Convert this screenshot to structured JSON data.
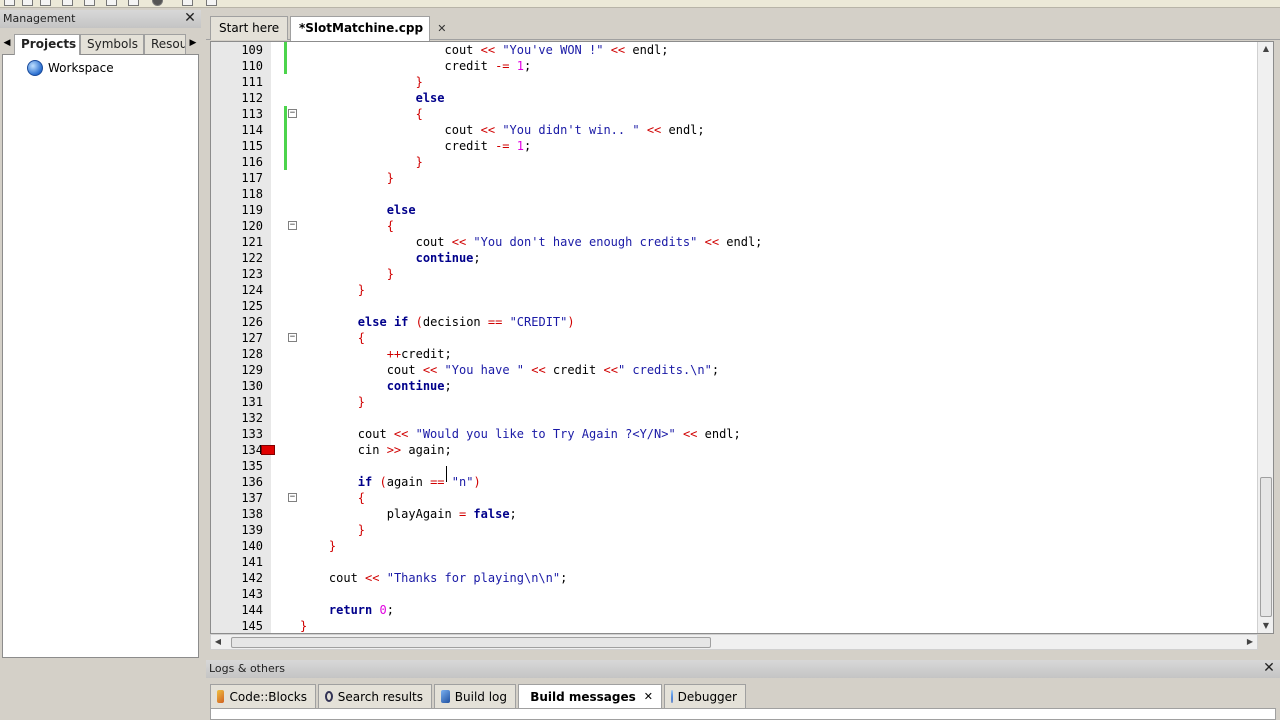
{
  "management_panel": {
    "title": "Management",
    "close_glyph": "✕",
    "tabs": [
      "Projects",
      "Symbols",
      "Resources"
    ],
    "active_tab": "Projects",
    "tree": {
      "root_label": "Workspace",
      "root_icon": "workspace-globe-icon"
    }
  },
  "editor": {
    "tabs": [
      {
        "label": "Start here",
        "active": false
      },
      {
        "label": "*SlotMatchine.cpp",
        "active": true,
        "close_glyph": "✕"
      }
    ],
    "lines": [
      {
        "num": "109",
        "code": "                    cout << \"You've WON !\" << endl;"
      },
      {
        "num": "110",
        "code": "                    credit -= 1;"
      },
      {
        "num": "111",
        "code": "                }"
      },
      {
        "num": "112",
        "code": "                else"
      },
      {
        "num": "113",
        "code": "                {"
      },
      {
        "num": "114",
        "code": "                    cout << \"You didn't win.. \" << endl;"
      },
      {
        "num": "115",
        "code": "                    credit -= 1;"
      },
      {
        "num": "116",
        "code": "                }"
      },
      {
        "num": "117",
        "code": "            }"
      },
      {
        "num": "118",
        "code": ""
      },
      {
        "num": "119",
        "code": "            else"
      },
      {
        "num": "120",
        "code": "            {"
      },
      {
        "num": "121",
        "code": "                cout << \"You don't have enough credits\" << endl;"
      },
      {
        "num": "122",
        "code": "                continue;"
      },
      {
        "num": "123",
        "code": "            }"
      },
      {
        "num": "124",
        "code": "        }"
      },
      {
        "num": "125",
        "code": ""
      },
      {
        "num": "126",
        "code": "        else if (decision == \"CREDIT\")"
      },
      {
        "num": "127",
        "code": "        {"
      },
      {
        "num": "128",
        "code": "            ++credit;"
      },
      {
        "num": "129",
        "code": "            cout << \"You have \" << credit <<\" credits.\\n\";"
      },
      {
        "num": "130",
        "code": "            continue;"
      },
      {
        "num": "131",
        "code": "        }"
      },
      {
        "num": "132",
        "code": ""
      },
      {
        "num": "133",
        "code": "        cout << \"Would you like to Try Again ?<Y/N>\" << endl;"
      },
      {
        "num": "134",
        "code": "        cin >> again;"
      },
      {
        "num": "135",
        "code": ""
      },
      {
        "num": "136",
        "code": "        if (again == \"n\")"
      },
      {
        "num": "137",
        "code": "        {"
      },
      {
        "num": "138",
        "code": "            playAgain = false;"
      },
      {
        "num": "139",
        "code": "        }"
      },
      {
        "num": "140",
        "code": "    }"
      },
      {
        "num": "141",
        "code": ""
      },
      {
        "num": "142",
        "code": "    cout << \"Thanks for playing\\n\\n\";"
      },
      {
        "num": "143",
        "code": ""
      },
      {
        "num": "144",
        "code": "    return 0;"
      },
      {
        "num": "145",
        "code": "}"
      }
    ],
    "changed_lines": [
      "109",
      "110",
      "113",
      "114",
      "115",
      "116"
    ],
    "fold_markers": [
      "113",
      "120",
      "127",
      "137"
    ],
    "breakpoint_lines": [
      "134"
    ],
    "scroll": {
      "vertical_position": 0.8,
      "horizontal_position": 0.0
    }
  },
  "logs_panel": {
    "title": "Logs & others",
    "close_glyph": "✕",
    "tabs": [
      {
        "label": "Code::Blocks",
        "icon": "codeblocks-icon",
        "active": false
      },
      {
        "label": "Search results",
        "icon": "search-icon",
        "active": false
      },
      {
        "label": "Build log",
        "icon": "build-log-icon",
        "active": false
      },
      {
        "label": "Build messages",
        "icon": "build-messages-icon",
        "active": true,
        "close_glyph": "✕"
      },
      {
        "label": "Debugger",
        "icon": "debugger-icon",
        "active": false
      }
    ]
  },
  "colors": {
    "keyword": "#00008b",
    "operator": "#d00000",
    "string": "#1a1aa6",
    "number": "#e000e0",
    "changed_marker": "#4cd44c",
    "breakpoint": "#e00000"
  }
}
